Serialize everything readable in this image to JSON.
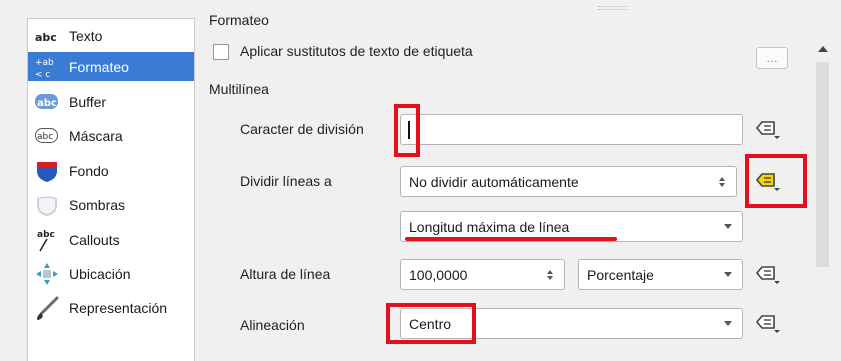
{
  "sidebar": {
    "items": [
      {
        "label": "Texto",
        "icon": "abc-text-icon"
      },
      {
        "label": "Formateo",
        "icon": "formatting-icon",
        "selected": true
      },
      {
        "label": "Buffer",
        "icon": "buffer-icon"
      },
      {
        "label": "Máscara",
        "icon": "mask-icon"
      },
      {
        "label": "Fondo",
        "icon": "background-shield-icon"
      },
      {
        "label": "Sombras",
        "icon": "shadow-icon"
      },
      {
        "label": "Callouts",
        "icon": "callouts-icon"
      },
      {
        "label": "Ubicación",
        "icon": "placement-icon"
      },
      {
        "label": "Representación",
        "icon": "rendering-brush-icon"
      }
    ]
  },
  "formatting": {
    "section_title": "Formateo",
    "apply_substitutes_label": "Aplicar sustitutos de texto de etiqueta",
    "more_button": "…"
  },
  "multiline": {
    "section_title": "Multilínea",
    "wrap_char_label": "Caracter de división",
    "wrap_char_value": "",
    "wrap_lines_label": "Dividir líneas a",
    "wrap_lines_value": "No dividir automáticamente",
    "wrap_length_mode": "Longitud máxima de línea",
    "line_height_label": "Altura de línea",
    "line_height_value": "100,0000",
    "line_height_unit": "Porcentaje",
    "alignment_label": "Alineación",
    "alignment_value": "Centro"
  },
  "colors": {
    "selection": "#3a7bd5",
    "highlight": "#e0101c",
    "active_override": "#f5d400"
  }
}
